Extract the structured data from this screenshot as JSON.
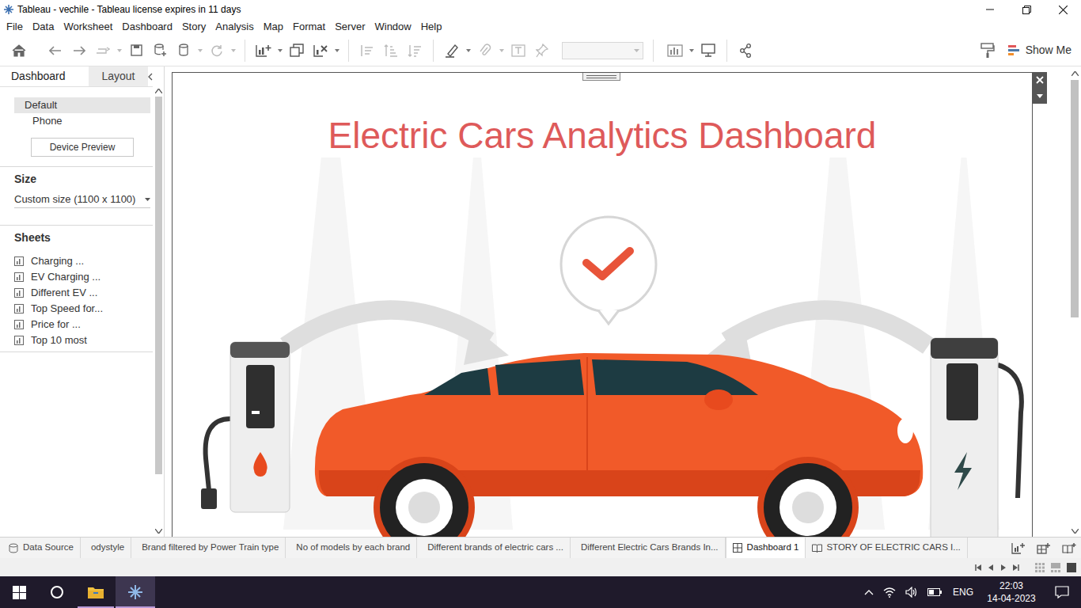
{
  "window": {
    "title": "Tableau - vechile - Tableau license expires in 11 days"
  },
  "menu": [
    "File",
    "Data",
    "Worksheet",
    "Dashboard",
    "Story",
    "Analysis",
    "Map",
    "Format",
    "Server",
    "Window",
    "Help"
  ],
  "toolbar": {
    "show_me": "Show Me"
  },
  "panel": {
    "tabs": [
      {
        "label": "Dashboard",
        "selected": true
      },
      {
        "label": "Layout",
        "selected": false
      }
    ],
    "devices": [
      {
        "label": "Default",
        "selected": true
      },
      {
        "label": "Phone",
        "selected": false
      }
    ],
    "device_preview": "Device Preview",
    "size_heading": "Size",
    "size_value": "Custom size (1100 x 1100)",
    "sheets_heading": "Sheets",
    "sheets": [
      "Charging ...",
      "EV Charging ...",
      "Different EV ...",
      "Top Speed for...",
      "Price for ...",
      "Top 10 most"
    ]
  },
  "dashboard": {
    "title": "Electric Cars Analytics Dashboard"
  },
  "sheet_tabs": [
    {
      "label": "Data Source",
      "selected": false,
      "kind": "source"
    },
    {
      "label": "odystyle",
      "selected": false,
      "kind": "sheet"
    },
    {
      "label": "Brand filtered by Power Train type",
      "selected": false,
      "kind": "sheet"
    },
    {
      "label": "No of models by each brand",
      "selected": false,
      "kind": "sheet"
    },
    {
      "label": "Different brands of electric cars ...",
      "selected": false,
      "kind": "sheet"
    },
    {
      "label": "Different Electric Cars Brands In...",
      "selected": false,
      "kind": "sheet"
    },
    {
      "label": "Dashboard 1",
      "selected": true,
      "kind": "dashboard"
    },
    {
      "label": "STORY OF ELECTRIC CARS I...",
      "selected": false,
      "kind": "story"
    }
  ],
  "taskbar": {
    "language": "ENG",
    "time": "22:03",
    "date": "14-04-2023"
  }
}
